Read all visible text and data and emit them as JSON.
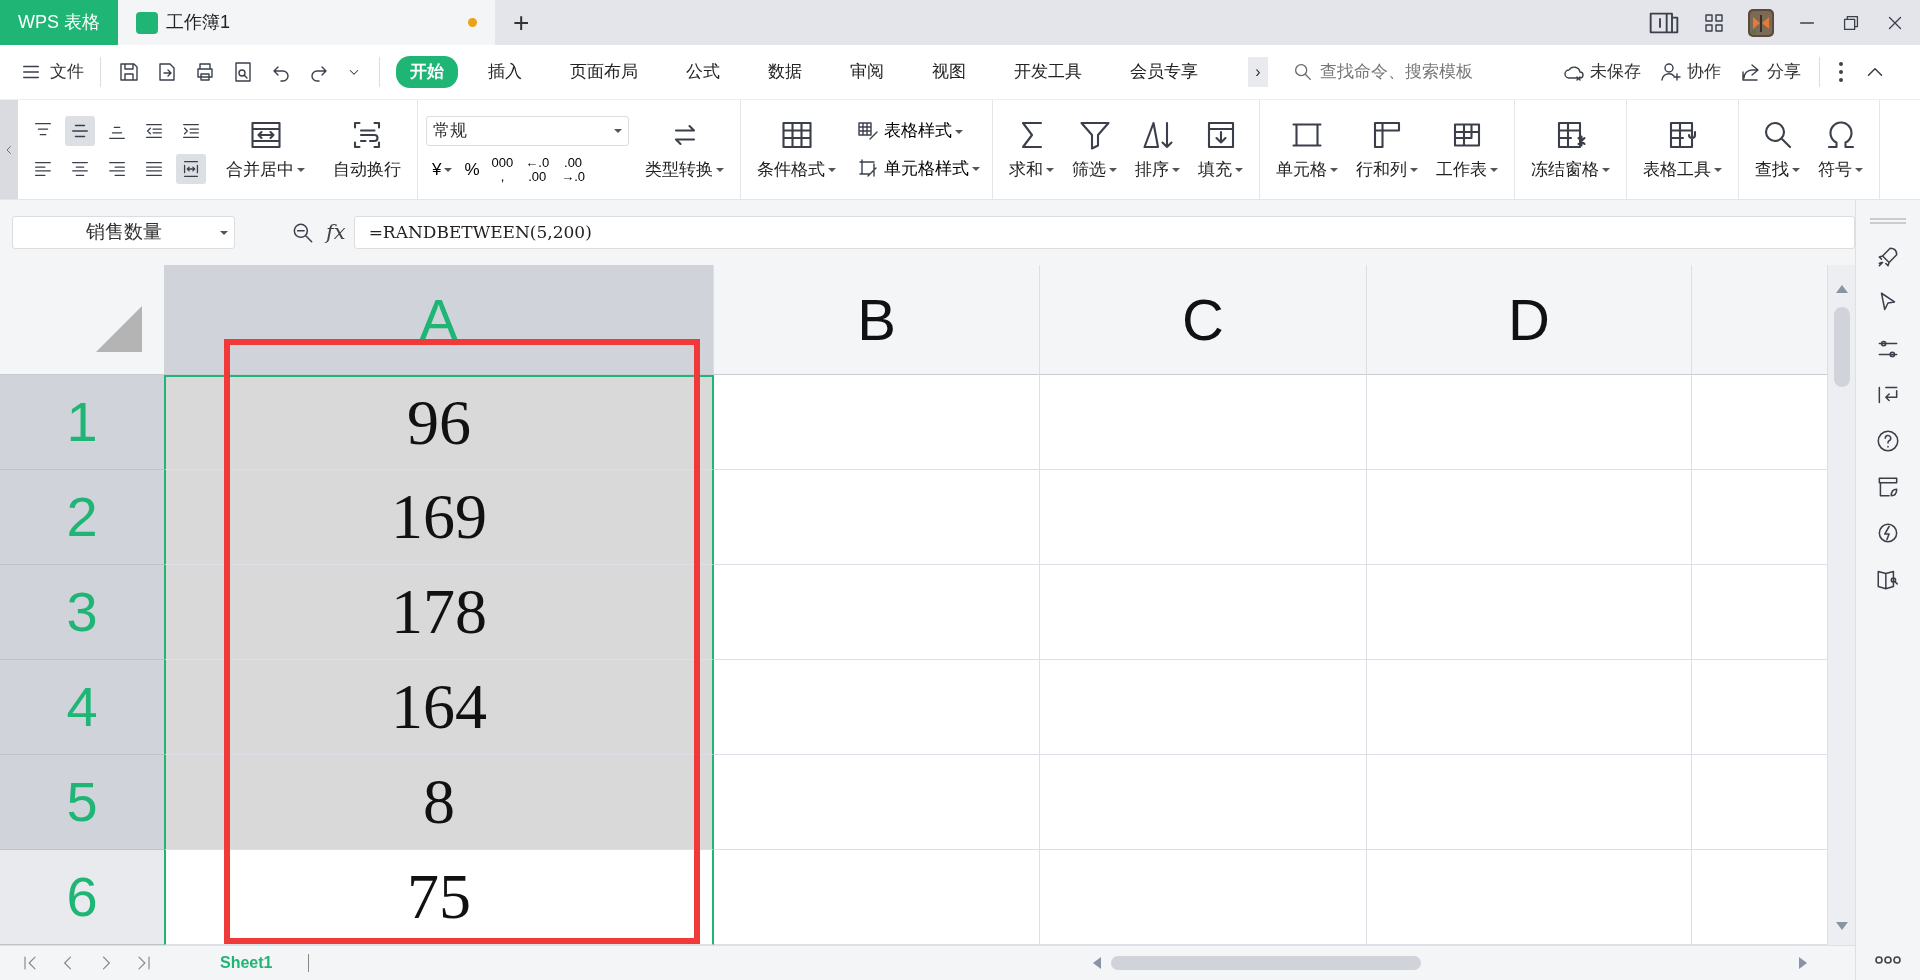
{
  "title_bar": {
    "app_tab": "WPS 表格",
    "doc_tab": {
      "title": "工作簿1",
      "unsaved": true
    },
    "new_tab": "+"
  },
  "menu_bar": {
    "file": "文件",
    "tabs": [
      {
        "label": "开始",
        "selected": true
      },
      {
        "label": "插入",
        "selected": false
      },
      {
        "label": "页面布局",
        "selected": false
      },
      {
        "label": "公式",
        "selected": false
      },
      {
        "label": "数据",
        "selected": false
      },
      {
        "label": "审阅",
        "selected": false
      },
      {
        "label": "视图",
        "selected": false
      },
      {
        "label": "开发工具",
        "selected": false
      },
      {
        "label": "会员专享",
        "selected": false
      }
    ],
    "more": "›",
    "search": {
      "placeholder": "查找命令、搜索模板"
    },
    "actions": [
      "未保存",
      "协作",
      "分享"
    ]
  },
  "ribbon": {
    "align_buttons": [
      {
        "selected": false
      },
      {
        "selected": true
      },
      {
        "selected": false
      },
      {
        "selected": false
      },
      {
        "selected": false
      },
      {
        "selected": false
      },
      {
        "selected": false
      },
      {
        "selected": false
      },
      {
        "selected": false
      },
      {
        "selected": true
      }
    ],
    "merge_items": [
      {
        "label": "合并居中",
        "dropdown": true
      },
      {
        "label": "自动换行",
        "dropdown": false
      }
    ],
    "number_format": "常规",
    "number_buttons": [
      {
        "lines": [
          "¥"
        ],
        "dropdown": true
      },
      {
        "lines": [
          "%"
        ],
        "dropdown": false
      },
      {
        "lines": [
          "000",
          ","
        ],
        "dropdown": false
      },
      {
        "lines": [
          "←.0",
          ".00"
        ],
        "dropdown": false
      },
      {
        "lines": [
          ".00",
          "→.0"
        ],
        "dropdown": false
      }
    ],
    "convert": {
      "label": "类型转换",
      "dropdown": true
    },
    "cond_format": {
      "label": "条件格式",
      "dropdown": true
    },
    "style_items": [
      {
        "label": "表格样式",
        "dropdown": true
      },
      {
        "label": "单元格样式",
        "dropdown": true
      }
    ],
    "groups": [
      [
        {
          "label": "求和",
          "dropdown": true
        },
        {
          "label": "筛选",
          "dropdown": true
        },
        {
          "label": "排序",
          "dropdown": true
        },
        {
          "label": "填充",
          "dropdown": true
        }
      ],
      [
        {
          "label": "单元格",
          "dropdown": true
        },
        {
          "label": "行和列",
          "dropdown": true
        },
        {
          "label": "工作表",
          "dropdown": true
        }
      ],
      [
        {
          "label": "冻结窗格",
          "dropdown": true
        }
      ],
      [
        {
          "label": "表格工具",
          "dropdown": true
        }
      ],
      [
        {
          "label": "查找",
          "dropdown": true
        },
        {
          "label": "符号",
          "dropdown": true
        }
      ]
    ]
  },
  "formula_bar": {
    "name_box": "销售数量",
    "fx": "fx",
    "formula": "=RANDBETWEEN(5,200)"
  },
  "sheet": {
    "columns": [
      {
        "label": "A",
        "selected": true
      },
      {
        "label": "B",
        "selected": false
      },
      {
        "label": "C",
        "selected": false
      },
      {
        "label": "D",
        "selected": false
      }
    ],
    "rows": [
      {
        "label": "1",
        "value": "96",
        "selected": true
      },
      {
        "label": "2",
        "value": "169",
        "selected": true
      },
      {
        "label": "3",
        "value": "178",
        "selected": true
      },
      {
        "label": "4",
        "value": "164",
        "selected": true
      },
      {
        "label": "5",
        "value": "8",
        "selected": true
      },
      {
        "label": "6",
        "value": "75",
        "selected": false
      }
    ]
  },
  "sheet_tabs": [
    {
      "label": "Sheet1",
      "selected": true
    }
  ],
  "annotation": {
    "kind": "frame"
  }
}
